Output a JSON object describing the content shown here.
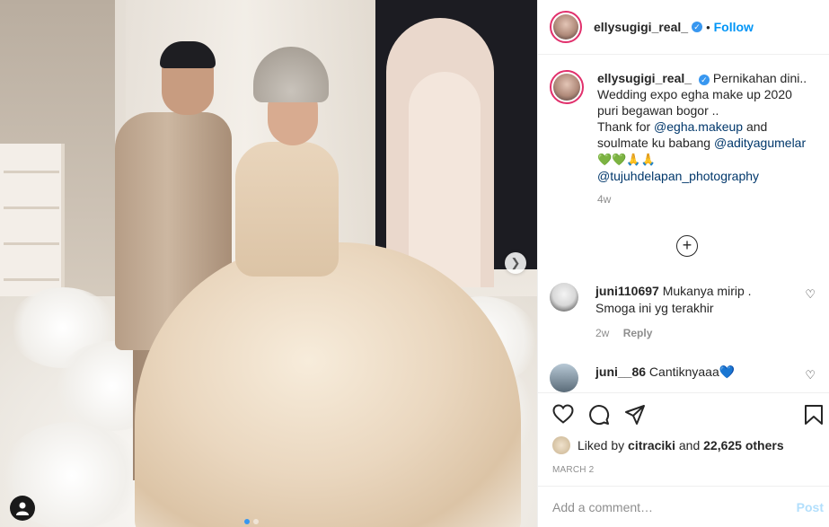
{
  "post": {
    "username": "ellysugigi_real_",
    "follow_label": "Follow",
    "separator": "•"
  },
  "caption": {
    "username": "ellysugigi_real_",
    "line1": "Pernikahan dini..",
    "line2": "Wedding expo egha make up 2020",
    "line3": "puri begawan bogor ..",
    "line4_prefix": "Thank for ",
    "mention1": "@egha.makeup",
    "line4_suffix": " and",
    "line5_prefix": "soulmate ku babang ",
    "mention2": "@adityagumelar",
    "emoji_green_hearts": "💚💚",
    "emoji_pray": "🙏🙏",
    "mention3": "@tujuhdelapan_photography",
    "time": "4w"
  },
  "comments": [
    {
      "username": "juni110697",
      "text": "Mukanya mirip .",
      "text2": "Smoga ini yg terakhir",
      "time": "2w",
      "reply_label": "Reply"
    },
    {
      "username": "juni__86",
      "text": "Cantiknyaaa",
      "emoji": "💙"
    }
  ],
  "likes": {
    "prefix": "Liked by ",
    "user": "citraciki",
    "middle": " and ",
    "count": "22,625 others"
  },
  "date": "MARCH 2",
  "comment_box": {
    "placeholder": "Add a comment…",
    "post_label": "Post"
  },
  "icons": {
    "heart": "heart-icon",
    "comment": "comment-icon",
    "share": "share-icon",
    "save": "bookmark-icon",
    "verified": "verified-badge-icon",
    "next": "chevron-right-icon",
    "tag": "user-tag-icon",
    "more": "plus-circle-icon"
  },
  "colors": {
    "accent": "#0095f6",
    "verified": "#3897f0",
    "story_ring": "#e1306c",
    "post_disabled": "#b2dffc",
    "muted": "#8e8e8e"
  }
}
